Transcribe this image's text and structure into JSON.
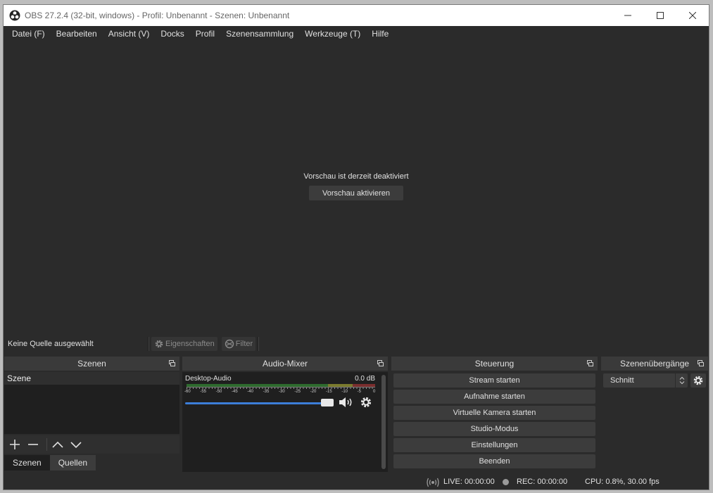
{
  "window": {
    "title": "OBS 27.2.4 (32-bit, windows) - Profil: Unbenannt - Szenen: Unbenannt",
    "controls": [
      "minimize-icon",
      "maximize-icon",
      "close-icon"
    ]
  },
  "menu": {
    "items": [
      "Datei (F)",
      "Bearbeiten",
      "Ansicht (V)",
      "Docks",
      "Profil",
      "Szenensammlung",
      "Werkzeuge (T)",
      "Hilfe"
    ]
  },
  "preview": {
    "message": "Vorschau ist derzeit deaktiviert",
    "button": "Vorschau aktivieren"
  },
  "source_bar": {
    "label": "Keine Quelle ausgewählt",
    "properties": "Eigenschaften",
    "filter": "Filter"
  },
  "scenes": {
    "title": "Szenen",
    "items": [
      "Szene"
    ],
    "tabs": [
      "Szenen",
      "Quellen"
    ]
  },
  "mixer": {
    "title": "Audio-Mixer",
    "channel": "Desktop-Audio",
    "db": "0.0 dB",
    "volume_fraction": 1.0,
    "scale": [
      "-60",
      "-55",
      "-50",
      "-45",
      "-40",
      "-35",
      "-30",
      "-25",
      "-20",
      "-15",
      "-10",
      "-5",
      "0"
    ]
  },
  "controls": {
    "title": "Steuerung",
    "buttons": [
      "Stream starten",
      "Aufnahme starten",
      "Virtuelle Kamera starten",
      "Studio-Modus",
      "Einstellungen",
      "Beenden"
    ]
  },
  "transitions": {
    "title": "Szenenübergänge",
    "selected": "Schnitt"
  },
  "status": {
    "live": "LIVE: 00:00:00",
    "rec": "REC: 00:00:00",
    "cpu": "CPU: 0.8%, 30.00 fps"
  },
  "colors": {
    "background": "#2b2b2b",
    "panel": "#1f1f1f",
    "button": "#3c3c3c",
    "volume_accent": "#3c7ed8"
  }
}
